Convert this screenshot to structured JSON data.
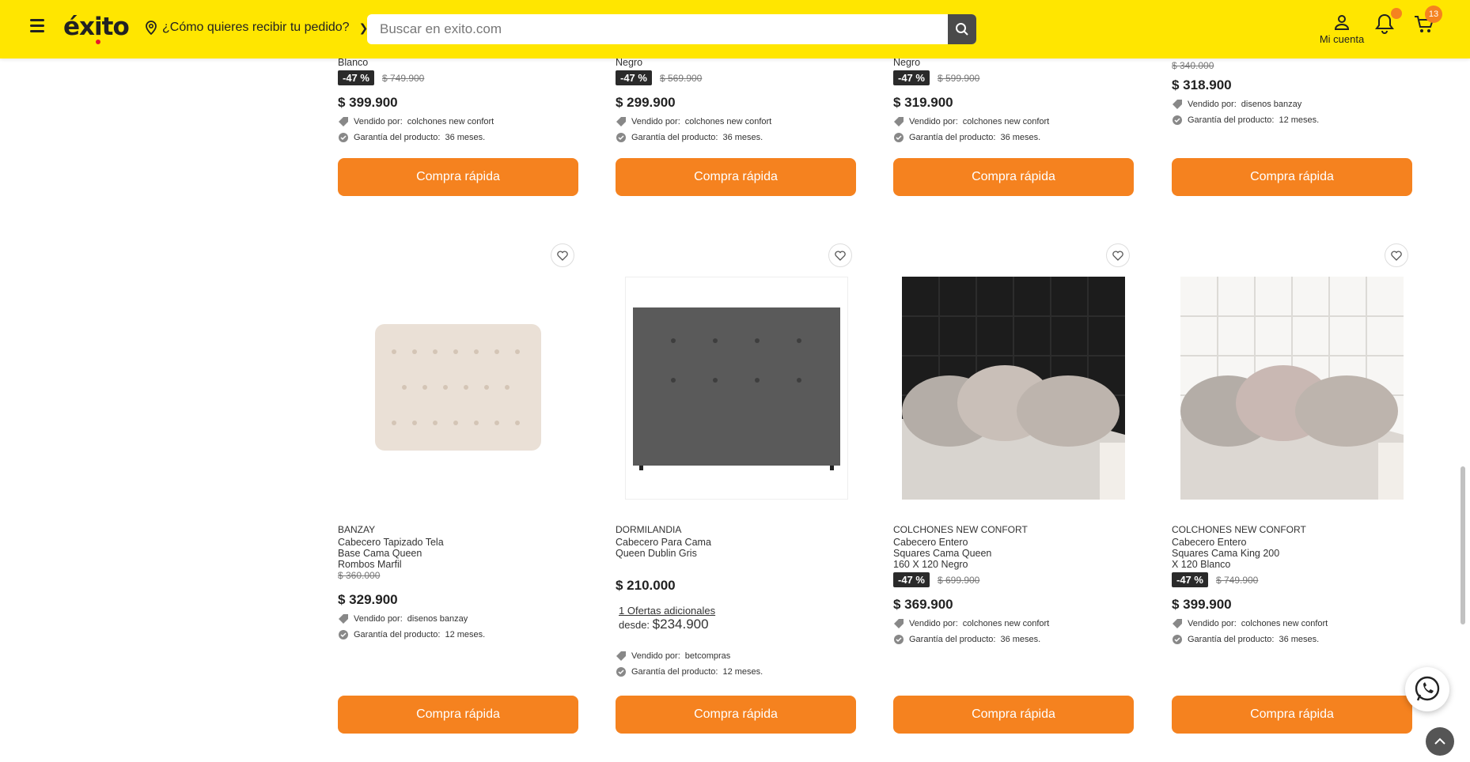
{
  "header": {
    "logo": "éxito",
    "delivery_prompt": "¿Cómo quieres recibir tu pedido?",
    "search_placeholder": "Buscar en exito.com",
    "account_label": "Mi cuenta",
    "cart_count": "13",
    "brand_color": "#ffe600",
    "accent_color": "#f5821f"
  },
  "top_row": [
    {
      "color": "Blanco",
      "discount": "-47 %",
      "old_price": "$ 749.900",
      "price": "$ 399.900",
      "sold_by_label": "Vendido por:",
      "seller": "colchones new confort",
      "warranty_label": "Garantía del producto:",
      "warranty": "36 meses.",
      "button": "Compra rápida"
    },
    {
      "color": "Negro",
      "discount": "-47 %",
      "old_price": "$ 569.900",
      "price": "$ 299.900",
      "sold_by_label": "Vendido por:",
      "seller": "colchones new confort",
      "warranty_label": "Garantía del producto:",
      "warranty": "36 meses.",
      "button": "Compra rápida"
    },
    {
      "color": "Negro",
      "discount": "-47 %",
      "old_price": "$ 599.900",
      "price": "$ 319.900",
      "sold_by_label": "Vendido por:",
      "seller": "colchones new confort",
      "warranty_label": "Garantía del producto:",
      "warranty": "36 meses.",
      "button": "Compra rápida"
    },
    {
      "old_price": "$ 340.000",
      "price": "$ 318.900",
      "sold_by_label": "Vendido por:",
      "seller": "disenos banzay",
      "warranty_label": "Garantía del producto:",
      "warranty": "12 meses.",
      "button": "Compra rápida"
    }
  ],
  "bottom_row": [
    {
      "brand": "BANZAY",
      "name_lines": [
        "Cabecero Tapizado Tela",
        "Base Cama Queen",
        "Rombos Marfil"
      ],
      "old_price": "$ 360.000",
      "price": "$ 329.900",
      "sold_by_label": "Vendido por:",
      "seller": "disenos banzay",
      "warranty_label": "Garantía del producto:",
      "warranty": "12 meses.",
      "button": "Compra rápida"
    },
    {
      "brand": "DORMILANDIA",
      "name_lines": [
        "Cabecero Para Cama",
        "Queen Dublin Gris"
      ],
      "price": "$ 210.000",
      "offers": "1 Ofertas adicionales",
      "from_label": "desde:",
      "from_price": "$234.900",
      "sold_by_label": "Vendido por:",
      "seller": "betcompras",
      "warranty_label": "Garantía del producto:",
      "warranty": "12 meses.",
      "button": "Compra rápida"
    },
    {
      "brand": "COLCHONES NEW CONFORT",
      "name_lines": [
        "Cabecero Entero",
        "Squares Cama Queen",
        "160 X 120 Negro"
      ],
      "discount": "-47 %",
      "old_price": "$ 699.900",
      "price": "$ 369.900",
      "sold_by_label": "Vendido por:",
      "seller": "colchones new confort",
      "warranty_label": "Garantía del producto:",
      "warranty": "36 meses.",
      "button": "Compra rápida"
    },
    {
      "brand": "COLCHONES NEW CONFORT",
      "name_lines": [
        "Cabecero Entero",
        "Squares Cama King 200",
        "X 120 Blanco"
      ],
      "discount": "-47 %",
      "old_price": "$ 749.900",
      "price": "$ 399.900",
      "sold_by_label": "Vendido por:",
      "seller": "colchones new confort",
      "warranty_label": "Garantía del producto:",
      "warranty": "36 meses.",
      "button": "Compra rápida"
    }
  ]
}
